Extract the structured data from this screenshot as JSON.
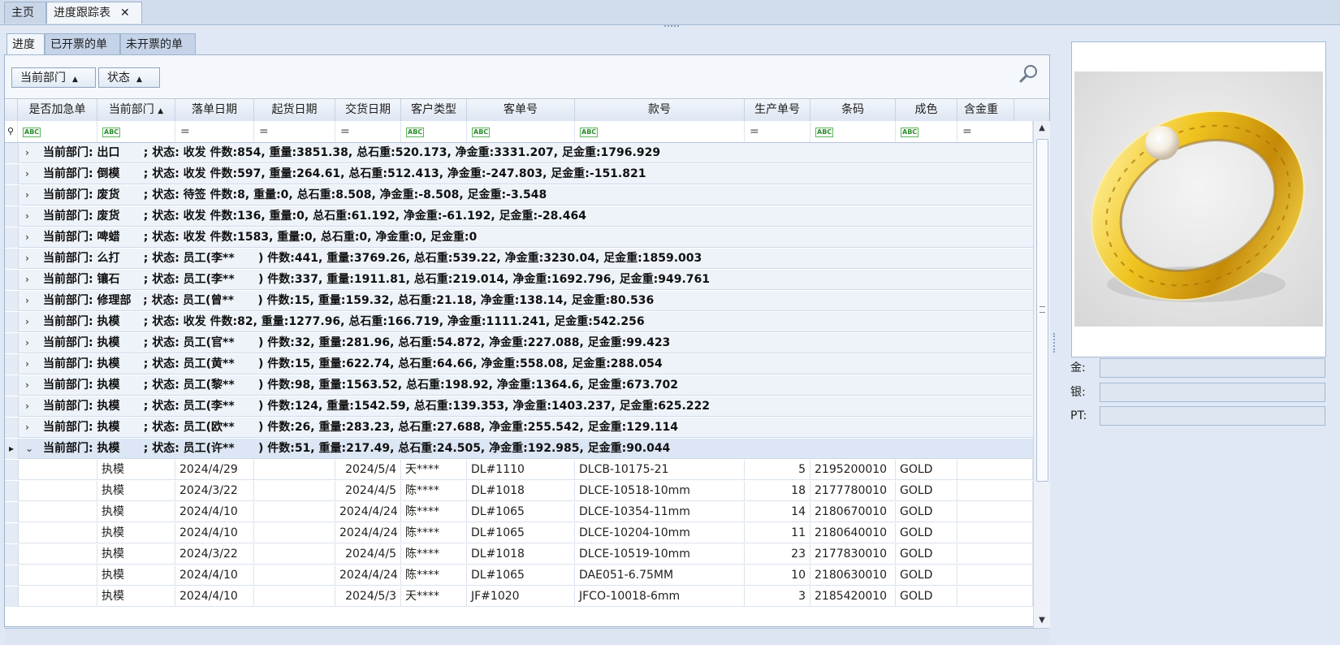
{
  "doc_tabs": {
    "home": "主页",
    "tracking": "进度跟踪表",
    "close": "✕"
  },
  "sub_tabs": [
    "进度",
    "已开票的单",
    "未开票的单"
  ],
  "group_buttons": [
    "当前部门",
    "状态"
  ],
  "columns": [
    "是否加急单",
    "当前部门",
    "落单日期",
    "起货日期",
    "交货日期",
    "客户类型",
    "客单号",
    "款号",
    "生产单号",
    "条码",
    "成色",
    "含金重"
  ],
  "groups": [
    "当前部门: 出口      ; 状态: 收发 件数:854, 重量:3851.38, 总石重:520.173, 净金重:3331.207, 足金重:1796.929",
    "当前部门: 倒模      ; 状态: 收发 件数:597, 重量:264.61, 总石重:512.413, 净金重:-247.803, 足金重:-151.821",
    "当前部门: 废货      ; 状态: 待签 件数:8, 重量:0, 总石重:8.508, 净金重:-8.508, 足金重:-3.548",
    "当前部门: 废货      ; 状态: 收发 件数:136, 重量:0, 总石重:61.192, 净金重:-61.192, 足金重:-28.464",
    "当前部门: 啤蜡      ; 状态: 收发 件数:1583, 重量:0, 总石重:0, 净金重:0, 足金重:0",
    "当前部门: 么打      ; 状态: 员工(李**      ) 件数:441, 重量:3769.26, 总石重:539.22, 净金重:3230.04, 足金重:1859.003",
    "当前部门: 镶石      ; 状态: 员工(李**      ) 件数:337, 重量:1911.81, 总石重:219.014, 净金重:1692.796, 足金重:949.761",
    "当前部门: 修理部   ; 状态: 员工(曾**      ) 件数:15, 重量:159.32, 总石重:21.18, 净金重:138.14, 足金重:80.536",
    "当前部门: 执模      ; 状态: 收发 件数:82, 重量:1277.96, 总石重:166.719, 净金重:1111.241, 足金重:542.256",
    "当前部门: 执模      ; 状态: 员工(官**      ) 件数:32, 重量:281.96, 总石重:54.872, 净金重:227.088, 足金重:99.423",
    "当前部门: 执模      ; 状态: 员工(黄**      ) 件数:15, 重量:622.74, 总石重:64.66, 净金重:558.08, 足金重:288.054",
    "当前部门: 执模      ; 状态: 员工(黎**      ) 件数:98, 重量:1563.52, 总石重:198.92, 净金重:1364.6, 足金重:673.702",
    "当前部门: 执模      ; 状态: 员工(李**      ) 件数:124, 重量:1542.59, 总石重:139.353, 净金重:1403.237, 足金重:625.222",
    "当前部门: 执模      ; 状态: 员工(欧**      ) 件数:26, 重量:283.23, 总石重:27.688, 净金重:255.542, 足金重:129.114",
    "当前部门: 执模      ; 状态: 员工(许**      ) 件数:51, 重量:217.49, 总石重:24.505, 净金重:192.985, 足金重:90.044"
  ],
  "rows": [
    [
      "执模",
      "2024/4/29",
      "",
      "2024/5/4",
      "天****",
      "DL#1110",
      "DLCB-10175-21",
      "5",
      "2195200010",
      "GOLD"
    ],
    [
      "执模",
      "2024/3/22",
      "",
      "2024/4/5",
      "陈****",
      "DL#1018",
      "DLCE-10518-10mm",
      "18",
      "2177780010",
      "GOLD"
    ],
    [
      "执模",
      "2024/4/10",
      "",
      "2024/4/24",
      "陈****",
      "DL#1065",
      "DLCE-10354-11mm",
      "14",
      "2180670010",
      "GOLD"
    ],
    [
      "执模",
      "2024/4/10",
      "",
      "2024/4/24",
      "陈****",
      "DL#1065",
      "DLCE-10204-10mm",
      "11",
      "2180640010",
      "GOLD"
    ],
    [
      "执模",
      "2024/3/22",
      "",
      "2024/4/5",
      "陈****",
      "DL#1018",
      "DLCE-10519-10mm",
      "23",
      "2177830010",
      "GOLD"
    ],
    [
      "执模",
      "2024/4/10",
      "",
      "2024/4/24",
      "陈****",
      "DL#1065",
      "DAE051-6.75MM",
      "10",
      "2180630010",
      "GOLD"
    ],
    [
      "执模",
      "2024/4/10",
      "",
      "2024/5/3",
      "天****",
      "JF#1020",
      "JFCO-10018-6mm",
      "3",
      "2185420010",
      "GOLD"
    ]
  ],
  "side": {
    "gold_label": "金:",
    "silver_label": "银:",
    "pt_label": "PT:",
    "gold_value": "",
    "silver_value": "",
    "pt_value": ""
  },
  "icons": {
    "search": "search-icon",
    "expand": "chevron-right-icon",
    "collapse": "chevron-down-icon",
    "row_pointer": "row-indicator-icon"
  },
  "colors": {
    "background": "#dfe8f4",
    "ring": "#e0b21a"
  }
}
